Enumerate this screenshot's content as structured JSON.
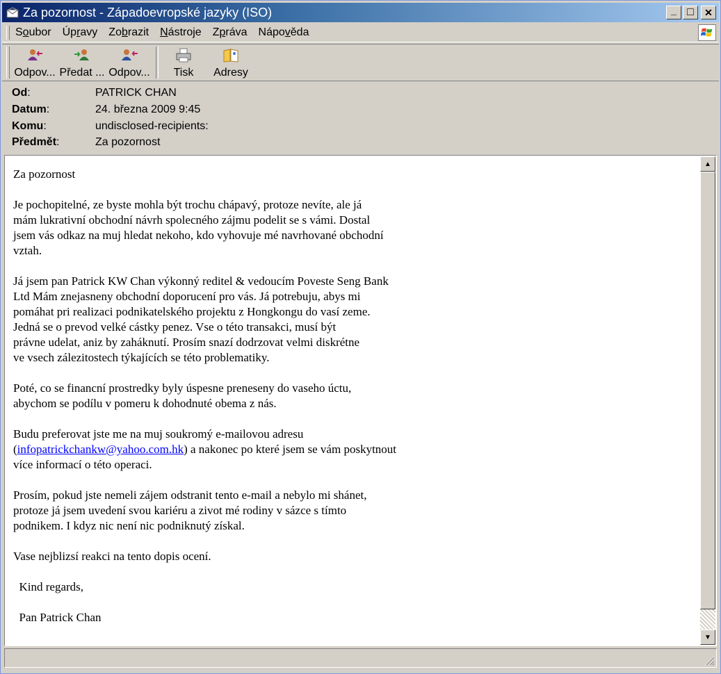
{
  "window": {
    "title": "Za pozornost  - Západoevropské jazyky (ISO)",
    "min_glyph": "_",
    "max_glyph": "□",
    "close_glyph": "✕"
  },
  "menu": {
    "items": [
      {
        "pre": "S",
        "u": "o",
        "post": "ubor"
      },
      {
        "pre": "Úp",
        "u": "r",
        "post": "avy"
      },
      {
        "pre": "Zo",
        "u": "b",
        "post": "razit"
      },
      {
        "pre": "",
        "u": "N",
        "post": "ástroje"
      },
      {
        "pre": "Z",
        "u": "p",
        "post": "ráva"
      },
      {
        "pre": "Nápo",
        "u": "v",
        "post": "ěda"
      }
    ]
  },
  "toolbar": {
    "reply": "Odpov...",
    "forward": "Předat ...",
    "reply_all": "Odpov...",
    "print": "Tisk",
    "addresses": "Adresy"
  },
  "headers": {
    "from_label": "Od",
    "from_colon": ":",
    "from_value": "PATRICK CHAN",
    "date_label": "Datum",
    "date_colon": ":",
    "date_value": "24. března 2009 9:45",
    "to_label": "Komu",
    "to_colon": ":",
    "to_value": "undisclosed-recipients:",
    "subject_label": "Předmět",
    "subject_colon": ":",
    "subject_value": "Za pozornost"
  },
  "message": {
    "p1": "Za pozornost",
    "p2": "Je pochopitelné, ze byste mohla být trochu chápavý, protoze nevíte, ale já\nmám lukrativní obchodní návrh spolecného zájmu podelit se s vámi. Dostal\njsem vás odkaz na muj hledat nekoho, kdo vyhovuje mé navrhované obchodní\nvztah.",
    "p3": "Já jsem pan Patrick KW Chan výkonný reditel & vedoucím Poveste Seng Bank\nLtd Mám znejasneny obchodní doporucení pro vás. Já potrebuju, abys mi\npomáhat pri realizaci podnikatelského projektu z Hongkongu do vasí zeme.\nJedná se o prevod velké cástky penez. Vse o této transakci, musí být\nprávne udelat, aniz by zaháknutí. Prosím snazí dodrzovat velmi diskrétne\nve vsech zálezitostech týkajících se této problematiky.",
    "p4": "Poté, co se financní prostredky byly úspesne preneseny do vaseho úctu,\nabychom se podílu v pomeru k dohodnuté obema z nás.",
    "p5a": "Budu preferovat jste me na muj soukromý e-mailovou adresu\n(",
    "p5_link": "infopatrickchankw@yahoo.com.hk",
    "p5b": ") a nakonec po které jsem se vám poskytnout\nvíce informací o této operaci.",
    "p6": "Prosím, pokud jste nemeli zájem odstranit tento e-mail a nebylo mi shánet,\nprotoze já jsem uvedení svou kariéru a zivot mé rodiny v sázce s tímto\npodnikem. I kdyz nic není nic podniknutý získal.",
    "p7": "Vase nejblizsí reakci na tento dopis ocení.",
    "p8": "  Kind regards,",
    "p9": "  Pan Patrick Chan"
  },
  "scrollbar": {
    "up_glyph": "▲",
    "down_glyph": "▼"
  }
}
